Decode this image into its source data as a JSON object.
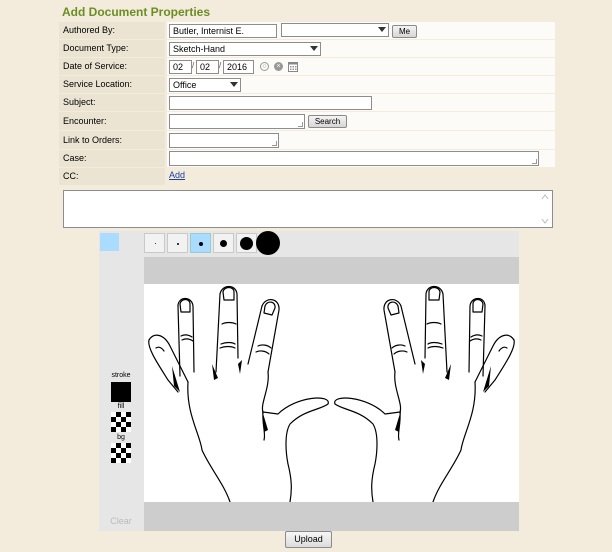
{
  "page": {
    "title": "Add Document Properties"
  },
  "form": {
    "authored_by": {
      "label": "Authored By:",
      "value": "Butler, Internist E.",
      "select_value": "",
      "me_button": "Me"
    },
    "document_type": {
      "label": "Document Type:",
      "value": "Sketch-Hand"
    },
    "date_of_service": {
      "label": "Date of Service:",
      "month": "02",
      "day": "02",
      "year": "2016"
    },
    "service_location": {
      "label": "Service Location:",
      "value": "Office"
    },
    "subject": {
      "label": "Subject:",
      "value": ""
    },
    "encounter": {
      "label": "Encounter:",
      "value": "",
      "search_button": "Search"
    },
    "link_to_orders": {
      "label": "Link to Orders:",
      "value": ""
    },
    "case": {
      "label": "Case:",
      "value": ""
    },
    "cc": {
      "label": "CC:",
      "add_link": "Add"
    }
  },
  "notes": {
    "value": ""
  },
  "sketch": {
    "selected_color": "#aadcff",
    "brush_sizes": [
      "xs",
      "s",
      "m",
      "l",
      "xl",
      "xxl"
    ],
    "selected_brush": "m",
    "stroke_label": "stroke",
    "fill_label": "fill",
    "bg_label": "bg",
    "clear_label": "Clear",
    "stroke_color": "#000000",
    "fill_color": "transparent",
    "bg_color": "transparent"
  },
  "upload_button": "Upload"
}
